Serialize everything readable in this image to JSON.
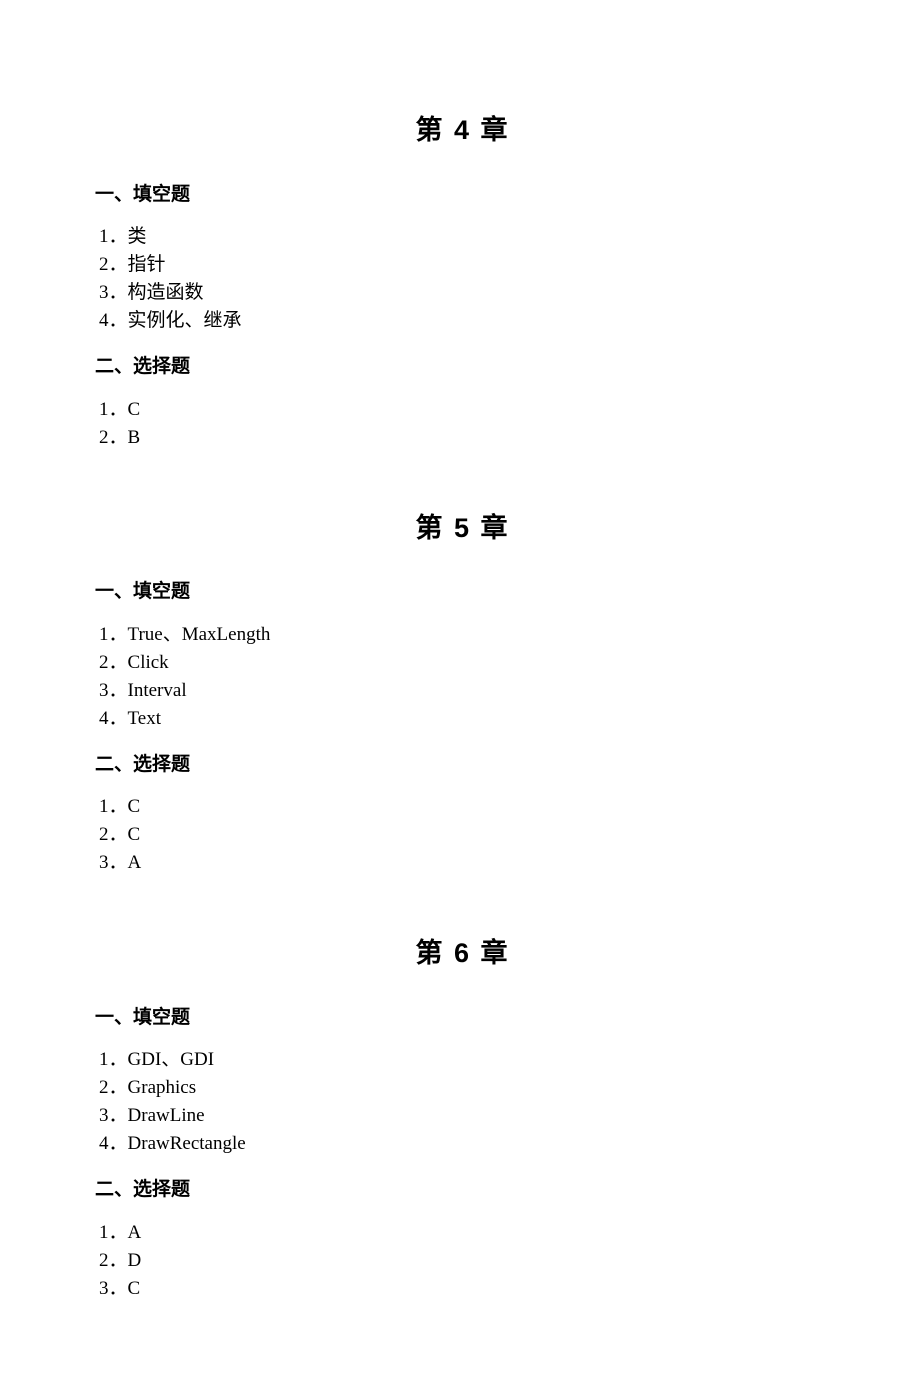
{
  "chapters": [
    {
      "title": "第 4 章",
      "sections": [
        {
          "heading": "一、填空题",
          "items": [
            {
              "num": "1",
              "text": "类"
            },
            {
              "num": "2",
              "text": "指针"
            },
            {
              "num": "3",
              "text": "构造函数"
            },
            {
              "num": "4",
              "text": "实例化、继承"
            }
          ]
        },
        {
          "heading": "二、选择题",
          "items": [
            {
              "num": "1",
              "text": "C"
            },
            {
              "num": "2",
              "text": "B"
            }
          ]
        }
      ]
    },
    {
      "title": "第 5 章",
      "sections": [
        {
          "heading": "一、填空题",
          "items": [
            {
              "num": "1",
              "text": "True、MaxLength"
            },
            {
              "num": "2",
              "text": "Click"
            },
            {
              "num": "3",
              "text": "Interval"
            },
            {
              "num": "4",
              "text": "Text"
            }
          ]
        },
        {
          "heading": "二、选择题",
          "items": [
            {
              "num": "1",
              "text": "C"
            },
            {
              "num": "2",
              "text": "C"
            },
            {
              "num": "3",
              "text": "A"
            }
          ]
        }
      ]
    },
    {
      "title": "第 6 章",
      "sections": [
        {
          "heading": "一、填空题",
          "items": [
            {
              "num": "1",
              "text": "GDI、GDI"
            },
            {
              "num": "2",
              "text": "Graphics"
            },
            {
              "num": "3",
              "text": "DrawLine"
            },
            {
              "num": "4",
              "text": "DrawRectangle"
            }
          ]
        },
        {
          "heading": "二、选择题",
          "items": [
            {
              "num": "1",
              "text": "A"
            },
            {
              "num": "2",
              "text": "D"
            },
            {
              "num": "3",
              "text": "C"
            }
          ]
        }
      ]
    }
  ]
}
